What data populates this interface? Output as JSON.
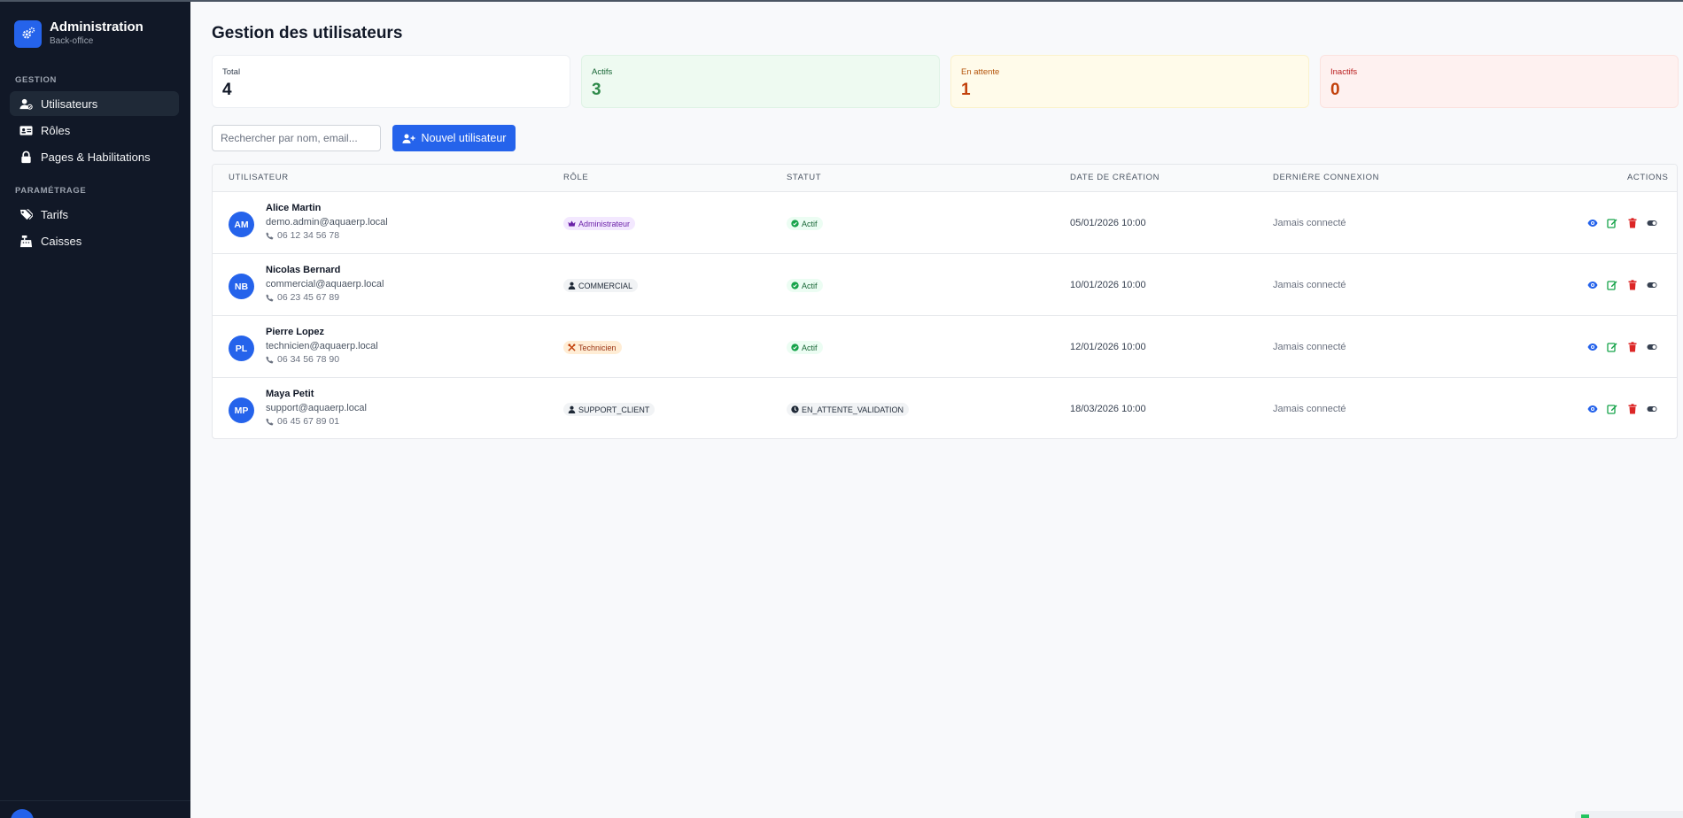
{
  "sidebar": {
    "brand_title": "Administration",
    "brand_subtitle": "Back-office",
    "section_gestion": "GESTION",
    "section_parametrage": "PARAMÉTRAGE",
    "items": [
      {
        "label": "Utilisateurs",
        "icon": "users-icon",
        "active": true
      },
      {
        "label": "Rôles",
        "icon": "id-card-icon",
        "active": false
      },
      {
        "label": "Pages & Habilitations",
        "icon": "lock-icon",
        "active": false
      },
      {
        "label": "Tarifs",
        "icon": "tags-icon",
        "active": false
      },
      {
        "label": "Caisses",
        "icon": "cash-register-icon",
        "active": false
      }
    ]
  },
  "page": {
    "title": "Gestion des utilisateurs"
  },
  "stats": {
    "total": {
      "label": "Total",
      "value": "4"
    },
    "actifs": {
      "label": "Actifs",
      "value": "3"
    },
    "attente": {
      "label": "En attente",
      "value": "1"
    },
    "inactifs": {
      "label": "Inactifs",
      "value": "0"
    }
  },
  "toolbar": {
    "search_placeholder": "Rechercher par nom, email...",
    "search_value": "",
    "new_user_label": "Nouvel utilisateur"
  },
  "table": {
    "headers": {
      "user": "UTILISATEUR",
      "role": "RÔLE",
      "status": "STATUT",
      "created": "DATE DE CRÉATION",
      "last_login": "DERNIÈRE CONNEXION",
      "actions": "ACTIONS"
    },
    "rows": [
      {
        "initials": "AM",
        "name": "Alice Martin",
        "email": "demo.admin@aquaerp.local",
        "phone": "06 12 34 56 78",
        "role": "Administrateur",
        "role_icon": "crown-icon",
        "status": "Actif",
        "status_icon": "check-circle-icon",
        "created": "05/01/2026 10:00",
        "last_login": "Jamais connecté"
      },
      {
        "initials": "NB",
        "name": "Nicolas Bernard",
        "email": "commercial@aquaerp.local",
        "phone": "06 23 45 67 89",
        "role": "COMMERCIAL",
        "role_icon": "user-icon",
        "status": "Actif",
        "status_icon": "check-circle-icon",
        "created": "10/01/2026 10:00",
        "last_login": "Jamais connecté"
      },
      {
        "initials": "PL",
        "name": "Pierre Lopez",
        "email": "technicien@aquaerp.local",
        "phone": "06 34 56 78 90",
        "role": "Technicien",
        "role_icon": "tools-icon",
        "status": "Actif",
        "status_icon": "check-circle-icon",
        "created": "12/01/2026 10:00",
        "last_login": "Jamais connecté"
      },
      {
        "initials": "MP",
        "name": "Maya Petit",
        "email": "support@aquaerp.local",
        "phone": "06 45 67 89 01",
        "role": "SUPPORT_CLIENT",
        "role_icon": "user-icon",
        "status": "EN_ATTENTE_VALIDATION",
        "status_icon": "clock-icon",
        "created": "18/03/2026 10:00",
        "last_login": "Jamais connecté"
      }
    ]
  },
  "colors": {
    "sidebar_bg": "#111827",
    "accent": "#2563eb",
    "view_icon": "#2563eb",
    "edit_icon": "#16a34a",
    "delete_icon": "#dc2626",
    "toggle_icon": "#374151"
  }
}
